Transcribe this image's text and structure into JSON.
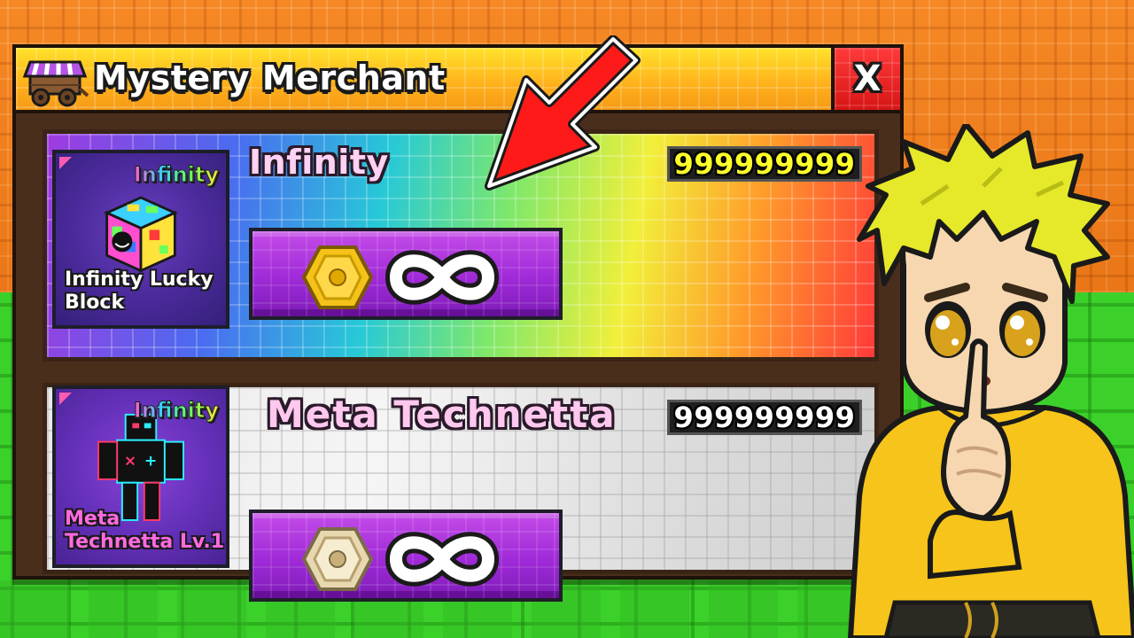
{
  "window": {
    "title": "Mystery Merchant",
    "close_label": "X"
  },
  "items": [
    {
      "rarity": "Infinity",
      "thumb_name": "Infinity Lucky Block",
      "title": "Infinity",
      "stock": "999999999",
      "price_icon": "gold-coin-icon",
      "price_symbol": "infinity-icon"
    },
    {
      "rarity": "Infinity",
      "thumb_name": "Meta Technetta Lv.1",
      "title": "Meta Technetta",
      "stock": "999999999",
      "price_icon": "silver-coin-icon",
      "price_symbol": "infinity-icon"
    }
  ],
  "colors": {
    "title_bar": "#ffb01c",
    "close_button": "#d61515",
    "buy_button": "#a02ad8",
    "stock_text_1": "#ffff2a",
    "stock_text_2": "#ffffff",
    "arrow": "#ff1a1a"
  },
  "decorations": {
    "arrow": "red-arrow-icon",
    "cart": "merchant-cart-icon",
    "character": "yellow-hair-avatar"
  }
}
